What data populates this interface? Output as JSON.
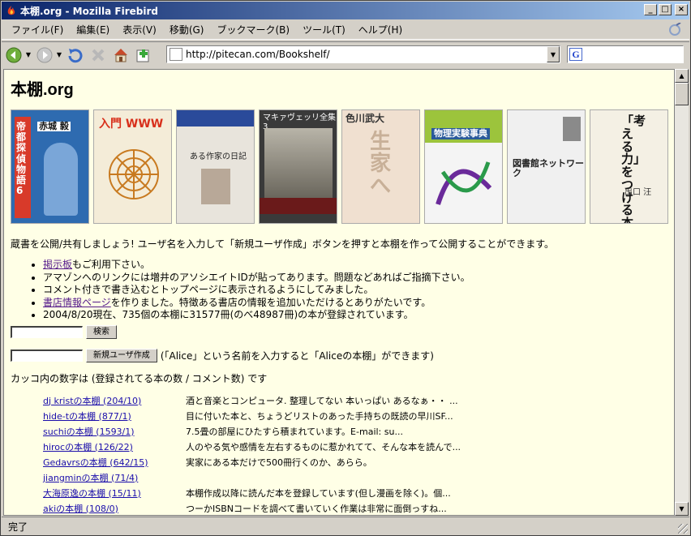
{
  "window": {
    "title": "本棚.org - Mozilla Firebird",
    "buttons": {
      "minimize": "_",
      "maximize": "□",
      "close": "×"
    }
  },
  "menu": [
    "ファイル(F)",
    "編集(E)",
    "表示(V)",
    "移動(G)",
    "ブックマーク(B)",
    "ツール(T)",
    "ヘルプ(H)"
  ],
  "toolbar": {
    "icons": [
      "back-icon",
      "forward-icon",
      "reload-icon",
      "stop-icon",
      "home-icon",
      "new-tab-icon"
    ]
  },
  "url": "http://pitecan.com/Bookshelf/",
  "search": {
    "value": "",
    "engine_letter": "G"
  },
  "page": {
    "site_title": "本棚",
    "site_suffix": ".org",
    "covers": [
      {
        "label": "帝都探偵物語 6",
        "author": "赤城 毅",
        "bg": "#2e6bb0"
      },
      {
        "label": "入門 WWW",
        "author": "",
        "bg": "#f4ecd8"
      },
      {
        "label": "ある作家の日記",
        "author": "",
        "bg": "#e8e4dc"
      },
      {
        "label": "マキァヴェッリ全集 3",
        "author": "",
        "bg": "#3a3a3a"
      },
      {
        "label": "生家へ",
        "author": "色川武大",
        "bg": "#f0e0d0"
      },
      {
        "label": "物理実験事典",
        "author": "",
        "bg": "#9cc43c"
      },
      {
        "label": "図書館ネットワーク",
        "author": "",
        "bg": "#f0f0f0"
      },
      {
        "label": "「考える力」をつける本",
        "author": "出口 汪",
        "bg": "#f4f0e4"
      }
    ],
    "intro": "蔵書を公開/共有しましょう! ユーザ名を入力して「新規ユーザ作成」ボタンを押すと本棚を作って公開することができます。",
    "news": [
      {
        "link": "掲示板",
        "text": "もご利用下さい。"
      },
      {
        "link": "",
        "text": "アマゾンへのリンクには増井のアソシエイトIDが貼ってあります。問題などあればご指摘下さい。"
      },
      {
        "link": "",
        "text": "コメント付きで書き込むとトップページに表示されるようにしてみました。"
      },
      {
        "link": "書店情報ページ",
        "text": "を作りました。特徴ある書店の情報を追加いただけるとありがたいです。"
      },
      {
        "link": "",
        "text": "2004/8/20現在、735個の本棚に31577冊(のべ48987冊)の本が登録されています。"
      }
    ],
    "search_button": "検索",
    "new_user_button": "新規ユーザ作成",
    "new_user_hint": "(「Alice」という名前を入力すると「Aliceの本棚」ができます)",
    "counts_note": "カッコ内の数字は (登録されてる本の数 / コメント数) です",
    "shelves": [
      {
        "name": "dj kristの本棚 (204/10)",
        "desc": "酒と音楽とコンピュータ. 整理してない 本いっぱい あるなぁ・・ ..."
      },
      {
        "name": "hide-tの本棚 (877/1)",
        "desc": "目に付いた本と、ちょうどリストのあった手持ちの既読の早川SF..."
      },
      {
        "name": "suchiの本棚 (1593/1)",
        "desc": "7.5畳の部屋にひたすら積まれています。E-mail: su..."
      },
      {
        "name": "hirocの本棚 (126/22)",
        "desc": "人のやる気や感情を左右するものに惹かれてて、そんな本を読んで..."
      },
      {
        "name": "Gedavrsの本棚 (642/15)",
        "desc": "実家にある本だけで500冊行くのか、あらら。"
      },
      {
        "name": "jiangminの本棚 (71/4)",
        "desc": ""
      },
      {
        "name": "大海原逸の本棚 (15/11)",
        "desc": "本棚作成以降に読んだ本を登録しています(但し漫画を除く)。個..."
      },
      {
        "name": "akiの本棚 (108/0)",
        "desc": "つーかISBNコードを調べて書いていく作業は非常に面倒っすね..."
      }
    ]
  },
  "status": "完了"
}
